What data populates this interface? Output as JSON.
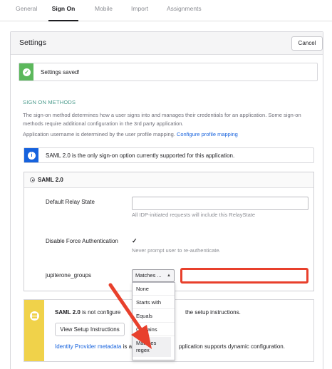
{
  "tabs": [
    "General",
    "Sign On",
    "Mobile",
    "Import",
    "Assignments"
  ],
  "panel": {
    "title": "Settings",
    "cancel_label": "Cancel"
  },
  "success_alert": {
    "text": "Settings saved!",
    "color": "#5cb85c"
  },
  "sign_on_methods": {
    "heading": "SIGN ON METHODS",
    "description": "The sign-on method determines how a user signs into and manages their credentials for an application. Some sign-on methods require additional configuration in the 3rd party application.",
    "username_text": "Application username is determined by the user profile mapping.",
    "mapping_link": "Configure profile mapping"
  },
  "info_alert": {
    "text": "SAML 2.0 is the only sign-on option currently supported for this application.",
    "color": "#1662dd"
  },
  "saml": {
    "label": "SAML 2.0",
    "relay_state_label": "Default Relay State",
    "relay_state_value": "",
    "relay_state_hint": "All IDP-initiated requests will include this RelayState",
    "force_auth_label": "Disable Force Authentication",
    "force_auth_checked": true,
    "force_auth_hint": "Never prompt user to re-authenticate.",
    "groups_label": "jupiterone_groups",
    "groups_filter_selected": "Matches ...",
    "groups_filter_value": "",
    "filter_options": [
      "None",
      "Starts with",
      "Equals",
      "Contains",
      "Matches regex"
    ]
  },
  "setup_box": {
    "text_bold": "SAML 2.0",
    "text_left": "is not configure",
    "text_right": "the setup instructions.",
    "button_label": "View Setup Instructions",
    "metadata_link": "Identity Provider metadata",
    "metadata_left": "is a",
    "metadata_right": "pplication supports dynamic configuration.",
    "accent_color": "#f0d24a"
  },
  "annotation_color": "#e8402c"
}
